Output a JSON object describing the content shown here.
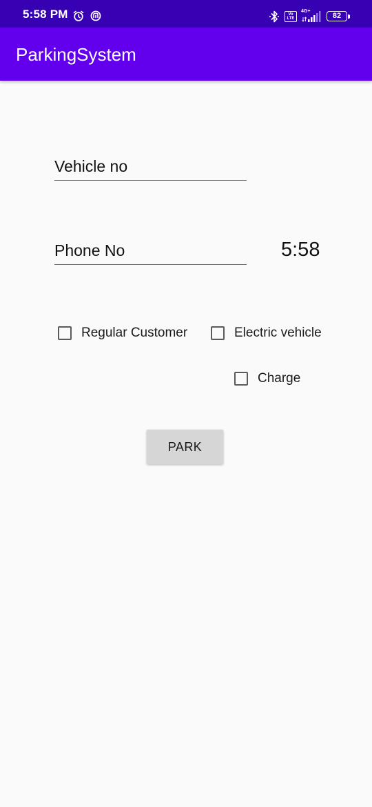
{
  "status_bar": {
    "time": "5:58 PM",
    "volte_label": "Vo\nLTE",
    "network_label": "4G+",
    "battery_level": "82",
    "icons": [
      "alarm-icon",
      "sync-icon",
      "bluetooth-icon",
      "volte-icon",
      "signal-icon",
      "battery-icon"
    ]
  },
  "app_bar": {
    "title": "ParkingSystem",
    "color": "#6200ee",
    "status_color": "#3700b3"
  },
  "form": {
    "vehicle_placeholder": "Vehicle no",
    "vehicle_value": "",
    "phone_placeholder": "Phone No",
    "phone_value": "",
    "clock": "5:58",
    "checkboxes": {
      "regular_customer": {
        "label": "Regular Customer",
        "checked": false
      },
      "electric_vehicle": {
        "label": "Electric vehicle",
        "checked": false
      },
      "charge": {
        "label": "Charge",
        "checked": false
      }
    },
    "park_button": "PARK"
  }
}
